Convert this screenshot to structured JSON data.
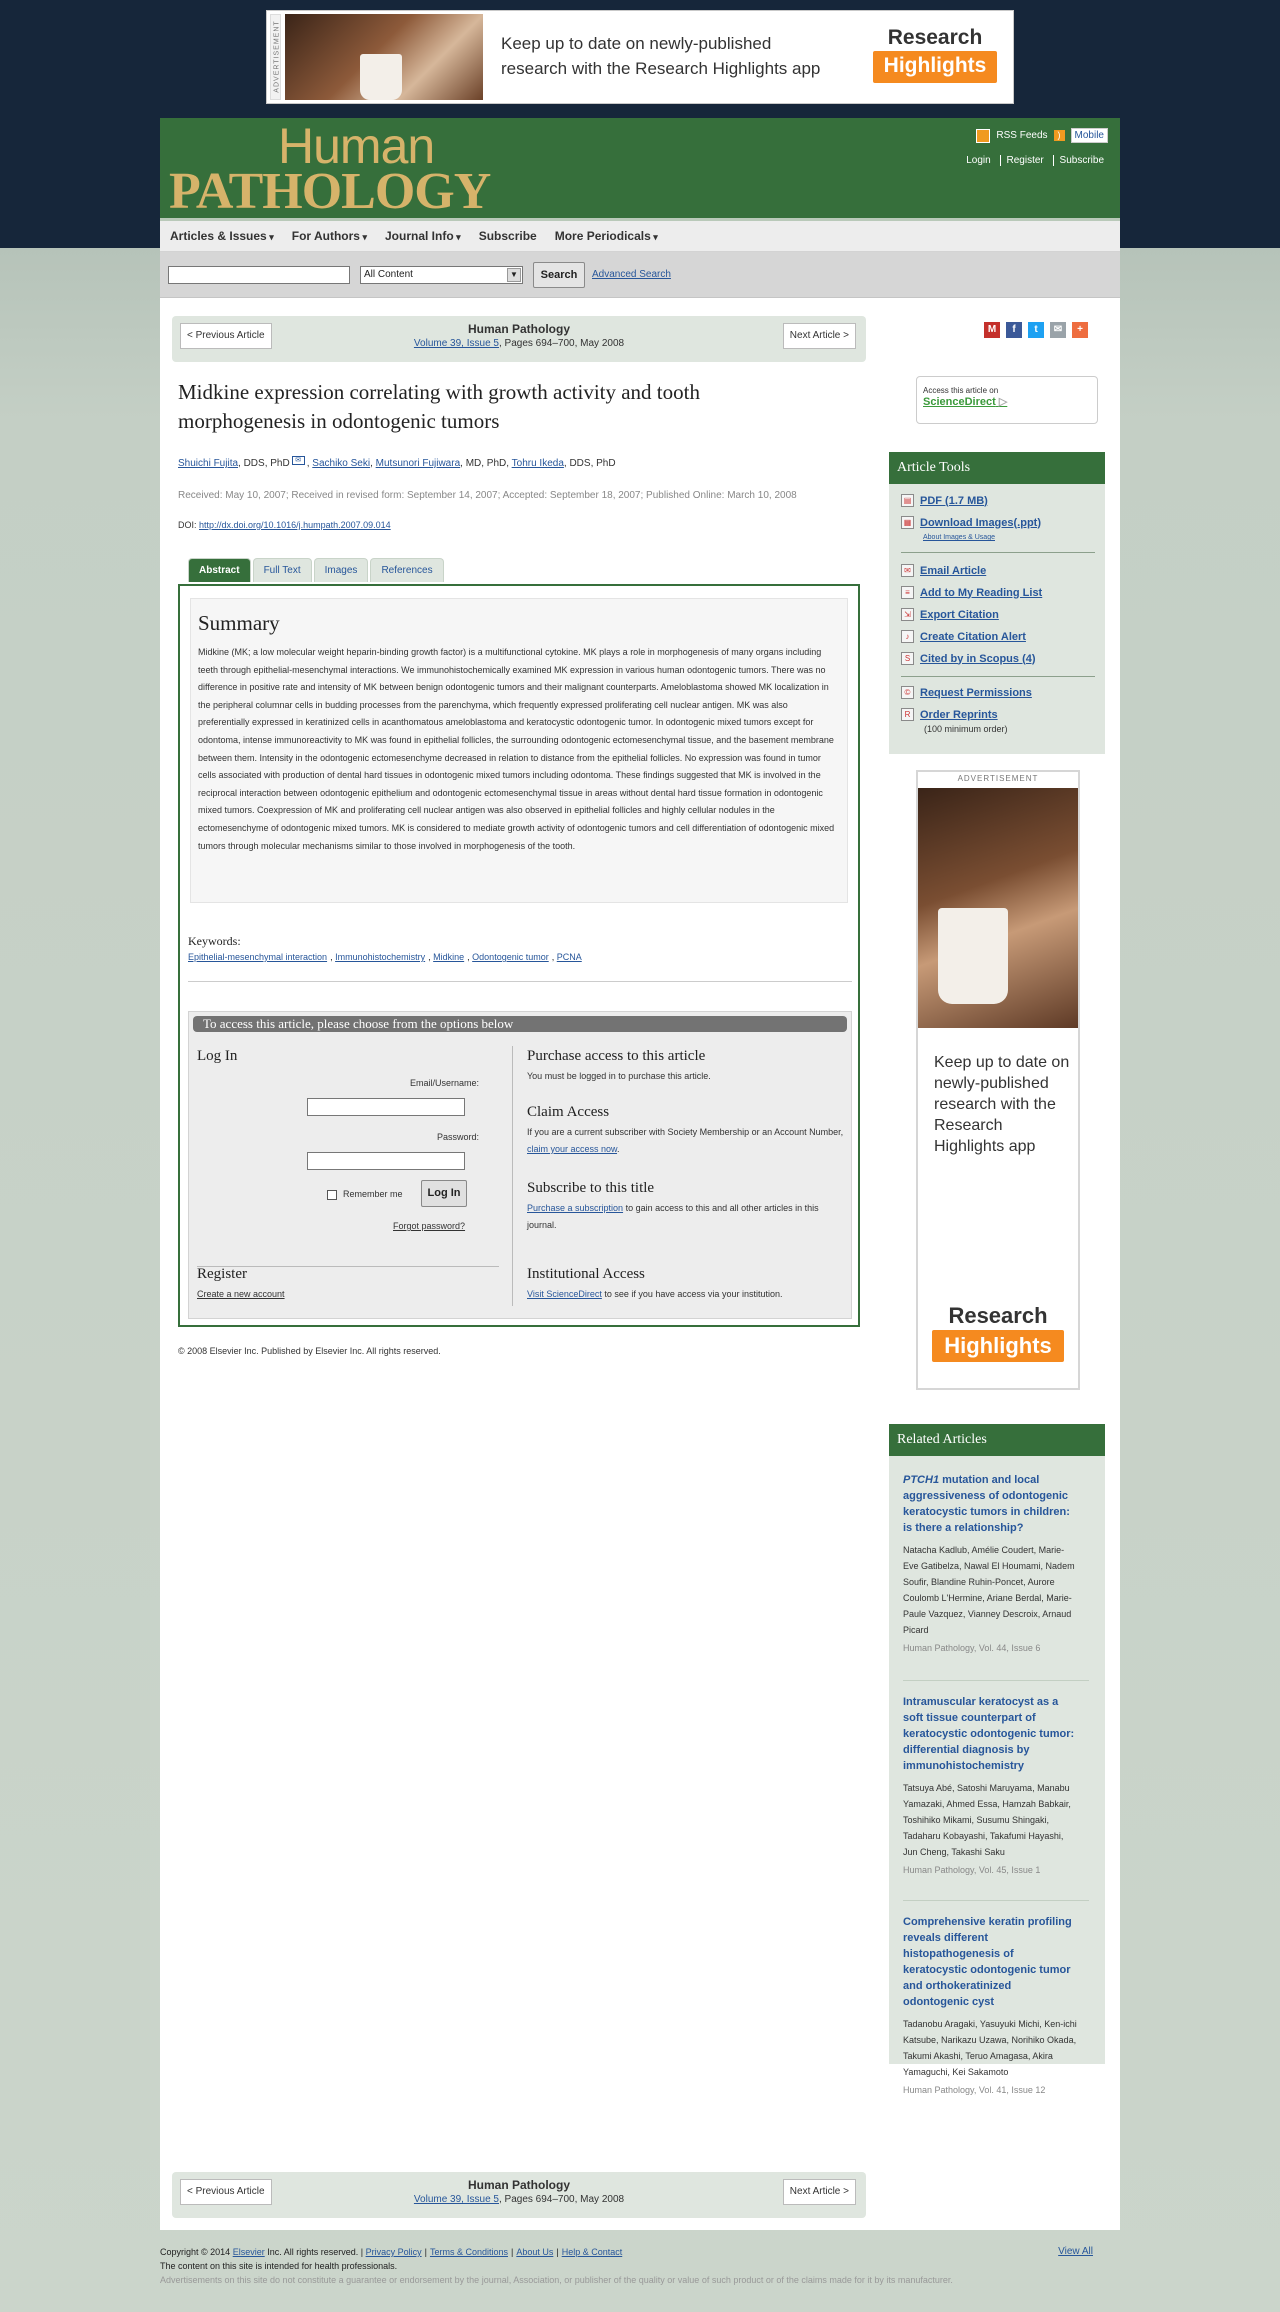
{
  "top_ad": {
    "side_label": "ADVERTISEMENT",
    "message": "Keep up to date on newly-published research with the Research Highlights app",
    "logo_line1": "Research",
    "logo_line2": "Highlights"
  },
  "header": {
    "logo_word1": "Human",
    "logo_word2": "PATHOLOGY",
    "rss": "RSS Feeds",
    "mobile": "Mobile",
    "login": "Login",
    "register": "Register",
    "subscribe": "Subscribe"
  },
  "nav": [
    "Articles & Issues",
    "For Authors",
    "Journal Info",
    "Subscribe",
    "More Periodicals"
  ],
  "search": {
    "scope": "All Content",
    "button": "Search",
    "advanced": "Advanced Search"
  },
  "article_nav": {
    "prev": "< Previous Article",
    "next": "Next Article >",
    "journal": "Human Pathology",
    "volume_link": "Volume 39, Issue 5",
    "pages": ", Pages 694–700, May 2008"
  },
  "article": {
    "title": "Midkine expression correlating with growth activity and tooth morphogenesis in odontogenic tumors",
    "authors": [
      {
        "name": "Shuichi Fujita",
        "suffix": ", DDS, PhD"
      },
      {
        "name": "Sachiko Seki",
        "suffix": ", "
      },
      {
        "name": "Mutsunori Fujiwara",
        "suffix": ", MD, PhD, "
      },
      {
        "name": "Tohru Ikeda",
        "suffix": ", DDS, PhD"
      }
    ],
    "dates": "Received: May 10, 2007; Received in revised form: September 14, 2007; Accepted: September 18, 2007; Published Online: March 10, 2008",
    "doi_label": "DOI: ",
    "doi": "http://dx.doi.org/10.1016/j.humpath.2007.09.014",
    "tabs": [
      "Abstract",
      "Full Text",
      "Images",
      "References"
    ],
    "summary_heading": "Summary",
    "summary": "Midkine (MK; a low molecular weight heparin-binding growth factor) is a multifunctional cytokine. MK plays a role in morphogenesis of many organs including teeth through epithelial-mesenchymal interactions. We immunohistochemically examined MK expression in various human odontogenic tumors. There was no difference in positive rate and intensity of MK between benign odontogenic tumors and their malignant counterparts. Ameloblastoma showed MK localization in the peripheral columnar cells in budding processes from the parenchyma, which frequently expressed proliferating cell nuclear antigen. MK was also preferentially expressed in keratinized cells in acanthomatous ameloblastoma and keratocystic odontogenic tumor. In odontogenic mixed tumors except for odontoma, intense immunoreactivity to MK was found in epithelial follicles, the surrounding odontogenic ectomesenchymal tissue, and the basement membrane between them. Intensity in the odontogenic ectomesenchyme decreased in relation to distance from the epithelial follicles. No expression was found in tumor cells associated with production of dental hard tissues in odontogenic mixed tumors including odontoma. These findings suggested that MK is involved in the reciprocal interaction between odontogenic epithelium and odontogenic ectomesenchymal tissue in areas without dental hard tissue formation in odontogenic mixed tumors. Coexpression of MK and proliferating cell nuclear antigen was also observed in epithelial follicles and highly cellular nodules in the ectomesenchyme of odontogenic mixed tumors. MK is considered to mediate growth activity of odontogenic tumors and cell differentiation of odontogenic mixed tumors through molecular mechanisms similar to those involved in morphogenesis of the tooth.",
    "keywords_label": "Keywords:",
    "keywords": [
      "Epithelial-mesenchymal interaction",
      "Immunohistochemistry",
      "Midkine",
      "Odontogenic tumor",
      "PCNA"
    ],
    "copyright": "© 2008 Elsevier Inc. Published by Elsevier Inc. All rights reserved."
  },
  "access": {
    "bar": "To access this article, please choose from the options below",
    "login_heading": "Log In",
    "email_label": "Email/Username:",
    "password_label": "Password:",
    "remember": "Remember me",
    "login_button": "Log In",
    "forgot": "Forgot password?",
    "register_heading": "Register",
    "create_account": "Create a new account",
    "purchase_heading": "Purchase access to this article",
    "purchase_text": "You must be logged in to purchase this article.",
    "claim_heading": "Claim Access",
    "claim_text": "If you are a current subscriber with Society Membership or an Account Number, ",
    "claim_link": "claim your access now",
    "claim_end": ".",
    "subscribe_heading": "Subscribe to this title",
    "subscribe_link": "Purchase a subscription",
    "subscribe_text": " to gain access to this and all other articles in this journal.",
    "institution_heading": "Institutional Access",
    "institution_link": "Visit ScienceDirect",
    "institution_text": " to see if you have access via your institution."
  },
  "sciencedirect": {
    "label": "Access this article on",
    "link": "ScienceDirect"
  },
  "tools": {
    "heading": "Article Tools",
    "pdf": "PDF (1.7 MB)",
    "download_images": "Download Images(.ppt)",
    "about_images": "About Images & Usage",
    "email": "Email Article",
    "reading_list": "Add to My Reading List",
    "export": "Export Citation",
    "alert": "Create Citation Alert",
    "scopus": "Cited by in Scopus (4)",
    "permissions": "Request Permissions",
    "reprints": "Order Reprints",
    "reprints_note": "(100 minimum order)"
  },
  "side_ad": {
    "label": "ADVERTISEMENT",
    "message": "Keep up to date on newly-published research with the Research Highlights app",
    "logo_line1": "Research",
    "logo_line2": "Highlights"
  },
  "related": {
    "heading": "Related Articles",
    "items": [
      {
        "title_italic": "PTCH1",
        "title": " mutation and local aggressiveness of odontogenic keratocystic tumors in children: is there a relationship?",
        "authors": "Natacha Kadlub, Amélie Coudert, Marie-Eve Gatibelza, Nawal El Houmami, Nadem Soufir, Blandine Ruhin-Poncet, Aurore Coulomb L'Hermine, Ariane Berdal, Marie-Paule Vazquez, Vianney Descroix, Arnaud Picard",
        "journal": "Human Pathology, Vol. 44, Issue 6"
      },
      {
        "title_italic": "",
        "title": "Intramuscular keratocyst as a soft tissue counterpart of keratocystic odontogenic tumor: differential diagnosis by immunohistochemistry",
        "authors": "Tatsuya Abé, Satoshi Maruyama, Manabu Yamazaki, Ahmed Essa, Hamzah Babkair, Toshihiko Mikami, Susumu Shingaki, Tadaharu Kobayashi, Takafumi Hayashi, Jun Cheng, Takashi Saku",
        "journal": "Human Pathology, Vol. 45, Issue 1"
      },
      {
        "title_italic": "",
        "title": "Comprehensive keratin profiling reveals different histopathogenesis of keratocystic odontogenic tumor and orthokeratinized odontogenic cyst",
        "authors": "Tadanobu Aragaki, Yasuyuki Michi, Ken-ichi Katsube, Narikazu Uzawa, Norihiko Okada, Takumi Akashi, Teruo Amagasa, Akira Yamaguchi, Kei Sakamoto",
        "journal": "Human Pathology, Vol. 41, Issue 12"
      }
    ],
    "view_all": "View All"
  },
  "footer": {
    "copyright_pre": "Copyright © 2014 ",
    "elsevier": "Elsevier",
    "copyright_post": " Inc. All rights reserved. | ",
    "privacy": "Privacy Policy",
    "terms": "Terms & Conditions",
    "about": "About Us",
    "help": "Help & Contact",
    "line2": "The content on this site is intended for health professionals.",
    "line3": "Advertisements on this site do not constitute a guarantee or endorsement by the journal, Association, or publisher of the quality or value of such product or of the claims made for it by its manufacturer."
  },
  "colors": {
    "header_green": "#366f3b",
    "logo_gold": "#d6b36a",
    "link_blue": "#27569a",
    "page_navy": "#16263a",
    "highlights_orange": "#f58a1f"
  }
}
